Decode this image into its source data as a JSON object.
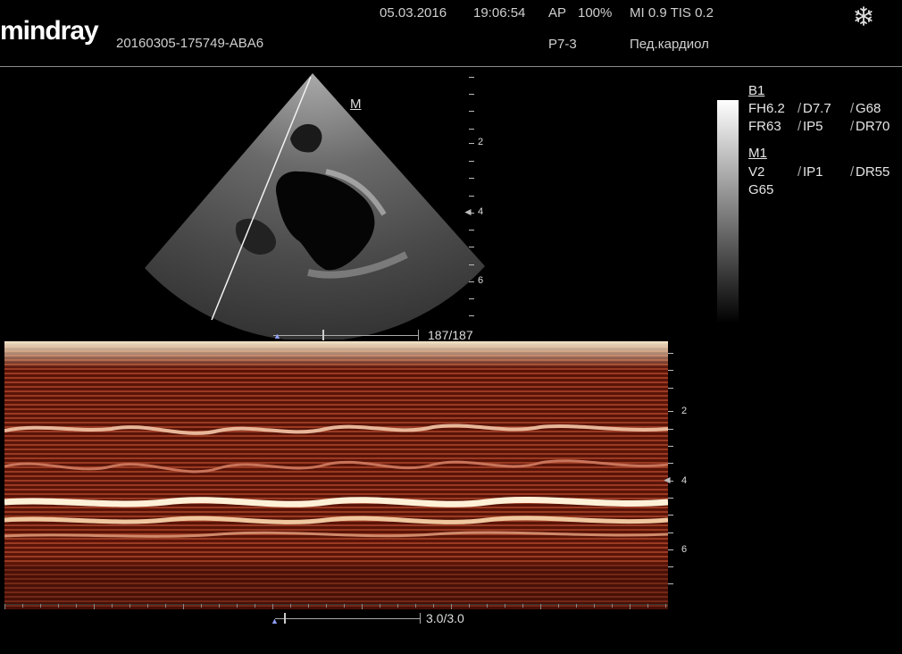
{
  "header": {
    "logo": "mindray",
    "patient_id": "20160305-175749-ABA6",
    "date": "05.03.2016",
    "time": "19:06:54",
    "ap_label": "AP",
    "ap_value": "100%",
    "mi_tis": "MI 0.9 TIS 0.2",
    "probe": "P7-3",
    "exam": "Пед.кардиол",
    "freeze_icon": "snowflake-icon"
  },
  "bmode": {
    "mode_label": "M",
    "depth_labels": [
      "2",
      "4",
      "6"
    ],
    "frame_counter": "187/187"
  },
  "mmode": {
    "depth_labels": [
      "2",
      "4",
      "6"
    ],
    "cine_counter": "3.0/3.0"
  },
  "params": {
    "b_title": "B1",
    "b_row1": [
      "FH6.2",
      "D7.7",
      "G68"
    ],
    "b_row2": [
      "FR63",
      "IP5",
      "DR70"
    ],
    "m_title": "M1",
    "m_row1": [
      "V2",
      "IP1",
      "DR55"
    ],
    "m_row2": [
      "G65"
    ]
  },
  "colors": {
    "mmode_tint": "#8b2a18",
    "text": "#e6e6e6",
    "separator": "#8a8a8a"
  }
}
